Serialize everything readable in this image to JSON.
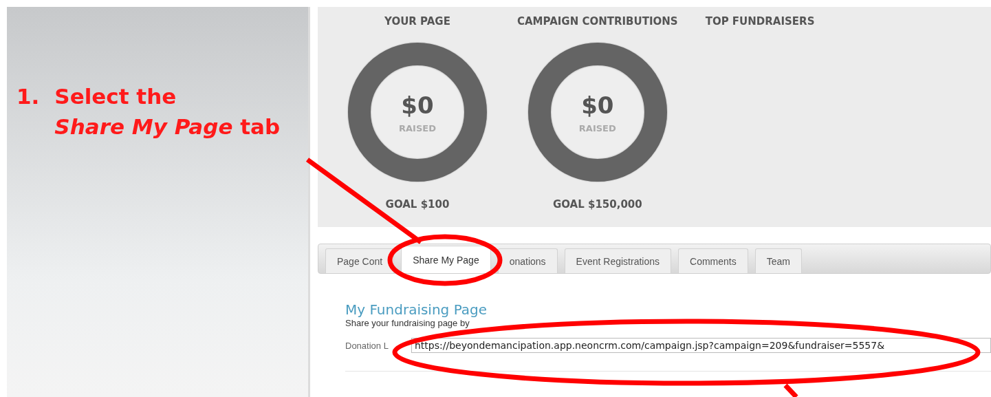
{
  "instruction": {
    "number": "1.",
    "line_1": "Select the",
    "emphasis": "Share My Page",
    "line_2_tail": "tab"
  },
  "stats": [
    {
      "title": "YOUR PAGE",
      "amount": "$0",
      "caption": "RAISED",
      "goal": "GOAL $100"
    },
    {
      "title": "CAMPAIGN CONTRIBUTIONS",
      "amount": "$0",
      "caption": "RAISED",
      "goal": "GOAL $150,000"
    },
    {
      "title": "TOP FUNDRAISERS"
    }
  ],
  "tabs": [
    {
      "label": "Page Cont",
      "selected": false
    },
    {
      "label": "Share My Page",
      "selected": true
    },
    {
      "label": "onations",
      "selected": false
    },
    {
      "label": "Event Registrations",
      "selected": false
    },
    {
      "label": "Comments",
      "selected": false
    },
    {
      "label": "Team",
      "selected": false
    }
  ],
  "section": {
    "title": "My Fundraising Page",
    "description": "Share your fundraising page by",
    "link_label": "Donation L",
    "link_value": "https://beyondemancipation.app.neoncrm.com/campaign.jsp?campaign=209&fundraiser=5557&"
  }
}
